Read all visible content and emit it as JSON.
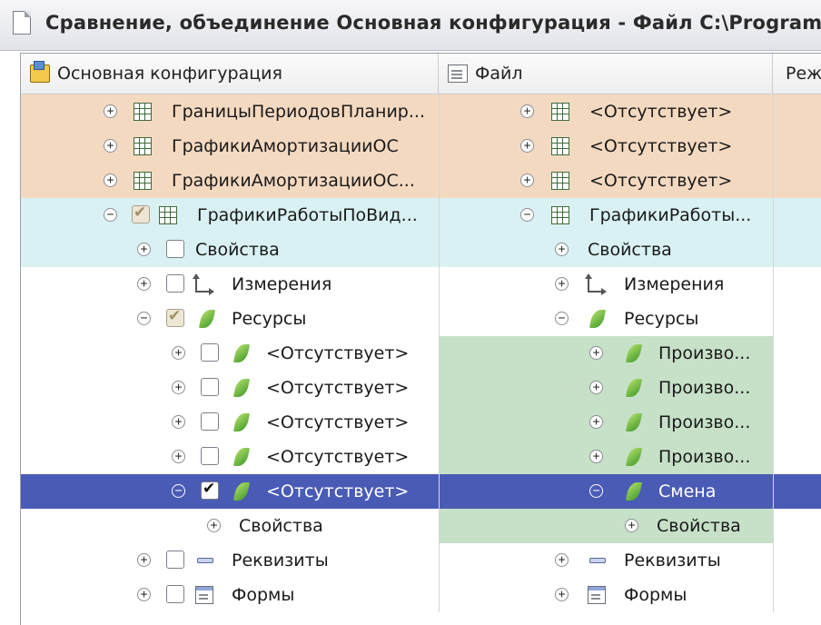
{
  "window": {
    "title": "Сравнение, объединение Основная конфигурация - Файл C:\\Program Fi",
    "icon": "document-icon"
  },
  "columns": {
    "left": {
      "label": "Основная конфигурация",
      "icon": "configuration-icon"
    },
    "right": {
      "label": "Файл",
      "icon": "file-icon"
    },
    "mode": {
      "label": "Реж"
    }
  },
  "colors": {
    "orange_row": "#f4d9c1",
    "cyan_row": "#daf1f3",
    "green_cell": "#c7e0c8",
    "selection": "#4a5bb6"
  },
  "rows": [
    {
      "left": "ГраницыПериодовПланир...",
      "right": "<Отсутствует>"
    },
    {
      "left": "ГрафикиАмортизацииОС",
      "right": "<Отсутствует>"
    },
    {
      "left": "ГрафикиАмортизацииОС...",
      "right": "<Отсутствует>"
    },
    {
      "left": "ГрафикиРаботыПоВид...",
      "right": "ГрафикиРаботы..."
    },
    {
      "left": "Свойства",
      "right": "Свойства"
    },
    {
      "left": "Измерения",
      "right": "Измерения"
    },
    {
      "left": "Ресурсы",
      "right": "Ресурсы"
    },
    {
      "left": "<Отсутствует>",
      "right": "Произво..."
    },
    {
      "left": "<Отсутствует>",
      "right": "Произво..."
    },
    {
      "left": "<Отсутствует>",
      "right": "Произво..."
    },
    {
      "left": "<Отсутствует>",
      "right": "Произво..."
    },
    {
      "left": "<Отсутствует>",
      "right": "Смена"
    },
    {
      "left": "Свойства",
      "right": "Свойства"
    },
    {
      "left": "Реквизиты",
      "right": "Реквизиты"
    },
    {
      "left": "Формы",
      "right": "Формы"
    }
  ]
}
